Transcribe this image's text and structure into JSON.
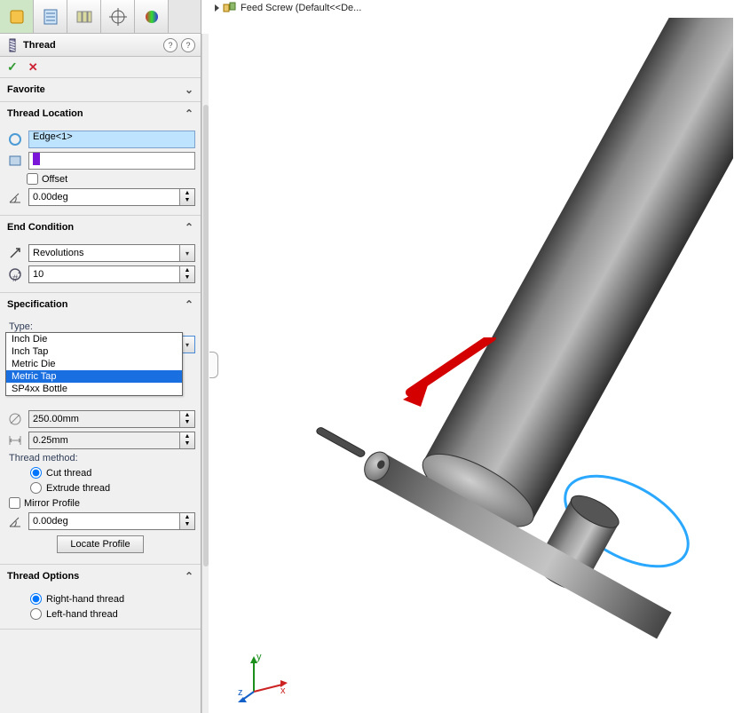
{
  "feature": {
    "name": "Thread"
  },
  "okrow": {
    "ok": "✓",
    "cancel": "✕"
  },
  "sections": {
    "favorite": {
      "title": "Favorite"
    },
    "threadLocation": {
      "title": "Thread Location",
      "edge": "Edge<1>",
      "offset_label": "Offset",
      "angle": "0.00deg"
    },
    "endCondition": {
      "title": "End Condition",
      "mode": "Revolutions",
      "count": "10"
    },
    "spec": {
      "title": "Specification",
      "type_label": "Type:",
      "type_value": "Metric Tap",
      "type_options": [
        "Inch Die",
        "Inch Tap",
        "Metric Die",
        "Metric Tap",
        "SP4xx Bottle"
      ],
      "size": "250.00mm",
      "pitch": "0.25mm",
      "method_label": "Thread method:",
      "cut": "Cut thread",
      "extrude": "Extrude thread",
      "mirror": "Mirror Profile",
      "mirror_angle": "0.00deg",
      "locate": "Locate Profile"
    },
    "options": {
      "title": "Thread Options",
      "rh": "Right-hand thread",
      "lh": "Left-hand thread"
    }
  },
  "graphics": {
    "tree_item": "Feed Screw  (Default<<De..."
  },
  "triad": {
    "x": "x",
    "y": "y",
    "z": "z"
  }
}
